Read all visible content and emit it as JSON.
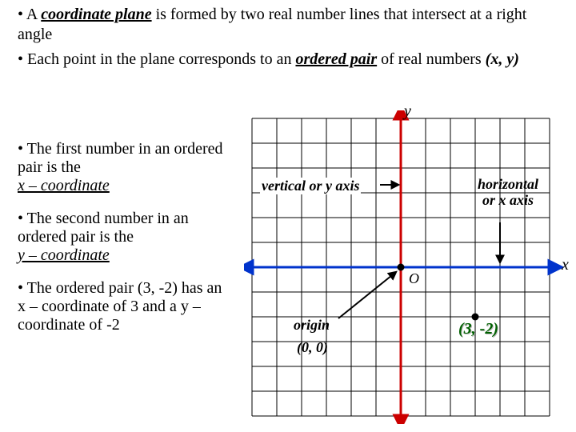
{
  "bullets": {
    "b1_prefix": " • A ",
    "b1_term": "coordinate plane",
    "b1_suffix": " is formed by two real number lines that intersect at a right angle",
    "b2_prefix": " • Each point in the plane corresponds to an ",
    "b2_term": "ordered pair",
    "b2_mid": " of real numbers ",
    "b2_pair": "(x, y)"
  },
  "left": {
    "p1_prefix": " • The first number in an ordered pair is the ",
    "p1_term": "x – coordinate",
    "p2_prefix": " • The second number in an ordered pair is the ",
    "p2_term": "y – coordinate",
    "p3": " • The ordered pair (3, -2) has an x – coordinate of  3 and a y – coordinate of  -2"
  },
  "graph": {
    "y_label": "y",
    "x_label": "x",
    "vertical_label": "vertical or y axis",
    "horizontal_label_line1": "horizontal",
    "horizontal_label_line2": "or x axis",
    "origin_symbol": "O",
    "origin_word": "origin",
    "origin_coord": "(0, 0)",
    "point_label": "(3, -2)"
  },
  "chart_data": {
    "type": "scatter",
    "title": "",
    "xlabel": "x",
    "ylabel": "y",
    "xlim": [
      -6,
      6
    ],
    "ylim": [
      -6,
      6
    ],
    "series": [
      {
        "name": "origin",
        "x": [
          0
        ],
        "y": [
          0
        ]
      },
      {
        "name": "example-point",
        "x": [
          3
        ],
        "y": [
          -2
        ]
      }
    ],
    "annotations": [
      "vertical or y axis",
      "horizontal or x axis",
      "origin",
      "(0, 0)",
      "(3, -2)",
      "O"
    ]
  }
}
